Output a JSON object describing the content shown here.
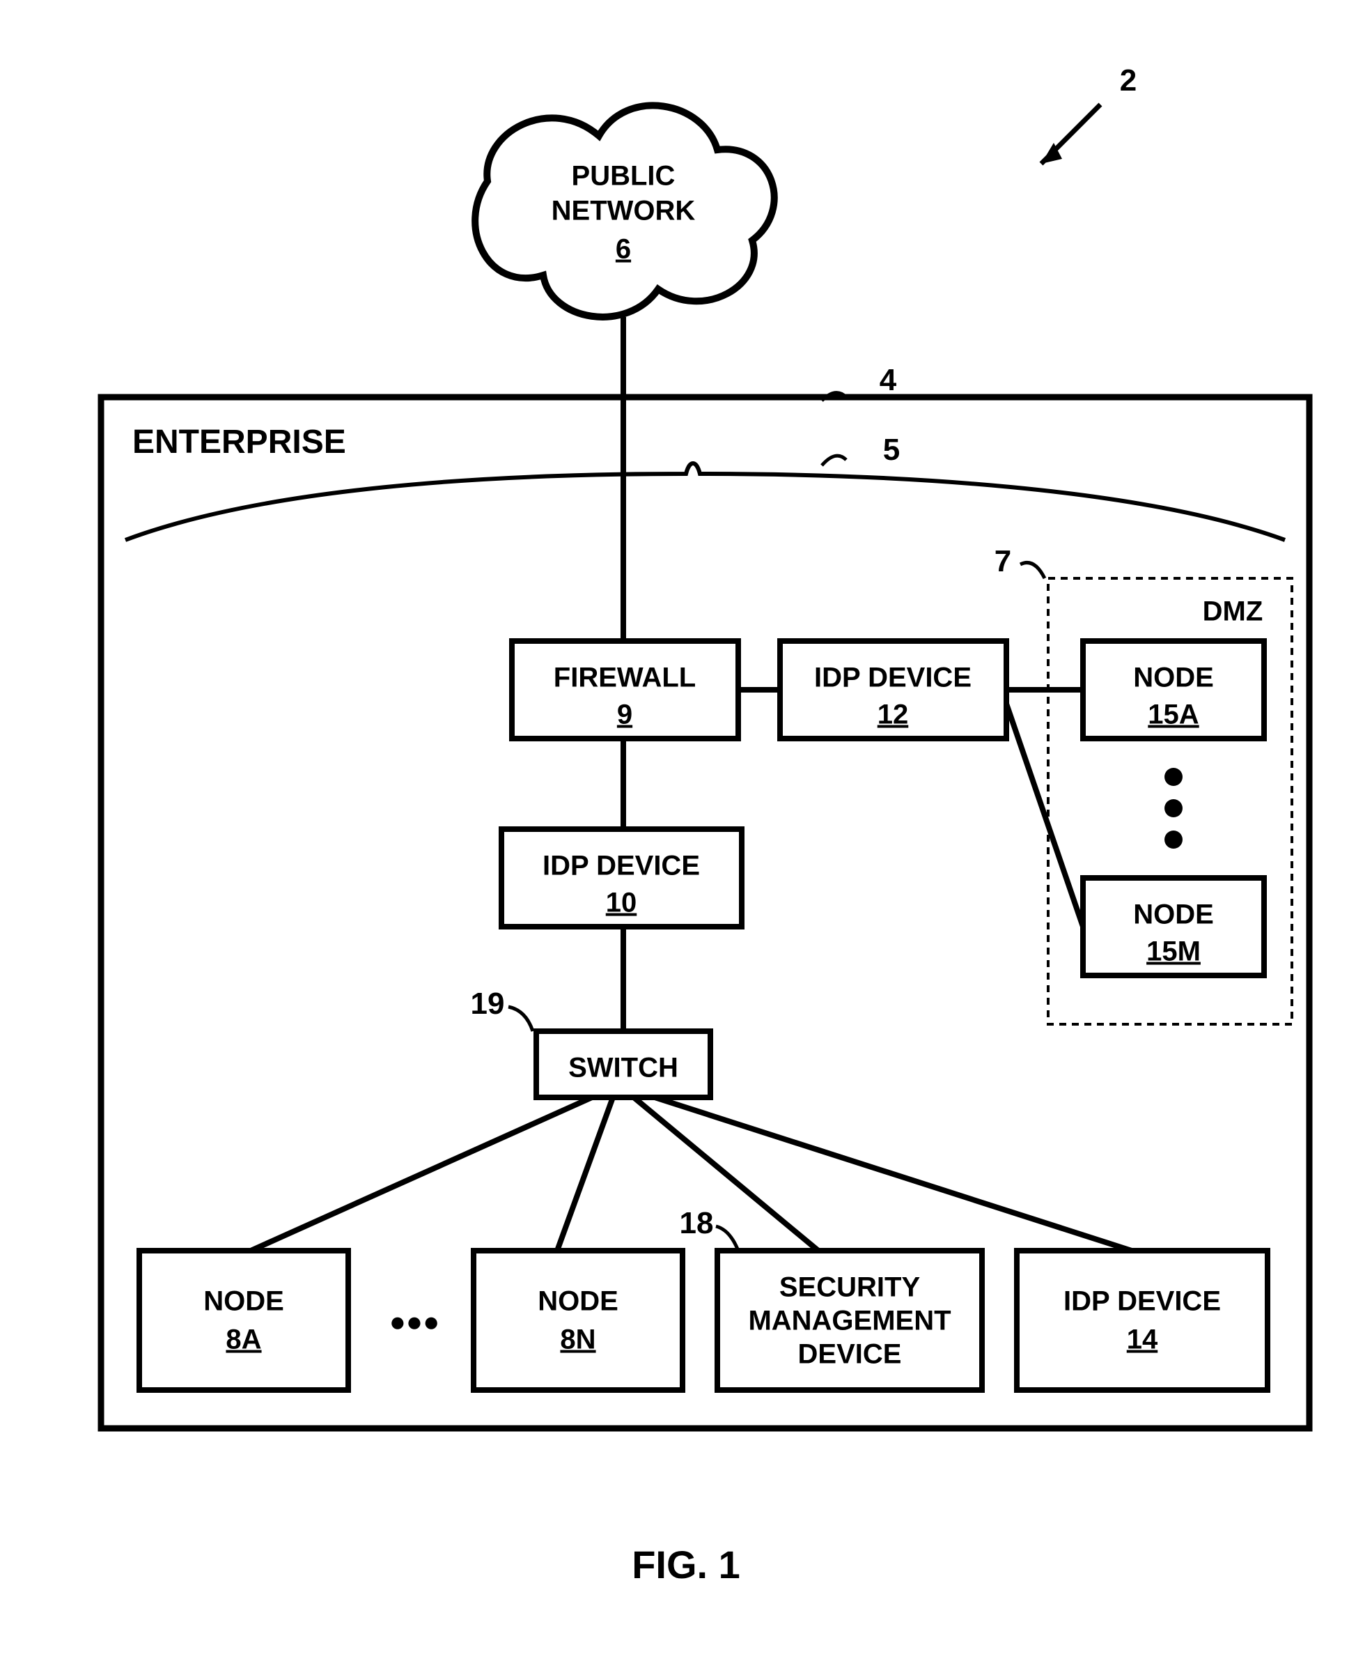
{
  "figure_ref": "2",
  "public_network": {
    "line1": "PUBLIC",
    "line2": "NETWORK",
    "ref": "6"
  },
  "enterprise": {
    "label": "ENTERPRISE",
    "ref": "4",
    "brace_ref": "5"
  },
  "dmz": {
    "label": "DMZ",
    "ref": "7"
  },
  "firewall": {
    "label": "FIREWALL",
    "ref": "9"
  },
  "idp12": {
    "label": "IDP DEVICE",
    "ref": "12"
  },
  "idp10": {
    "label": "IDP DEVICE",
    "ref": "10"
  },
  "switch": {
    "label": "SWITCH",
    "ref": "19"
  },
  "node8a": {
    "label": "NODE",
    "ref": "8A"
  },
  "node8n": {
    "label": "NODE",
    "ref": "8N"
  },
  "secmgmt": {
    "line1": "SECURITY",
    "line2": "MANAGEMENT",
    "line3": "DEVICE",
    "ref": "18"
  },
  "idp14": {
    "label": "IDP DEVICE",
    "ref": "14"
  },
  "node15a": {
    "label": "NODE",
    "ref": "15A"
  },
  "node15m": {
    "label": "NODE",
    "ref": "15M"
  },
  "ellipsis": "●●●",
  "figcaption": "FIG. 1"
}
